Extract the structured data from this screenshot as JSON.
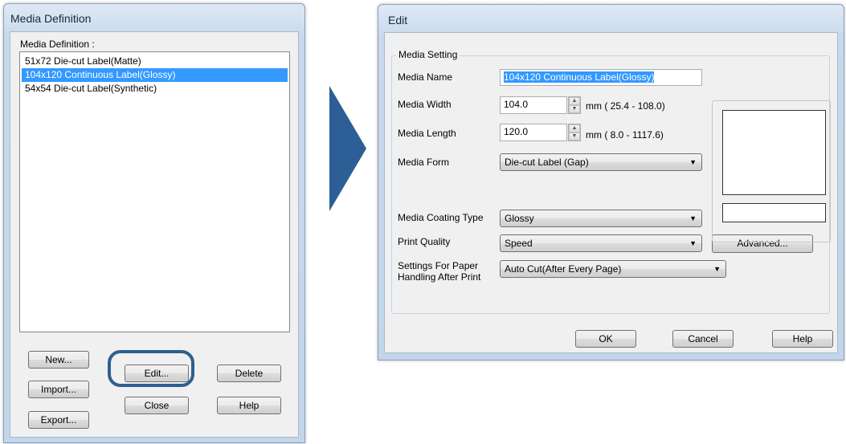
{
  "left_dialog": {
    "title": "Media Definition",
    "list_label": "Media Definition :",
    "items": [
      "51x72 Die-cut Label(Matte)",
      "104x120 Continuous Label(Glossy)",
      "54x54 Die-cut Label(Synthetic)"
    ],
    "selected_index": 1,
    "buttons": {
      "new": "New...",
      "import": "Import...",
      "export": "Export...",
      "edit": "Edit...",
      "close": "Close",
      "delete": "Delete",
      "help": "Help"
    }
  },
  "edit_dialog": {
    "title": "Edit",
    "group_title": "Media Setting",
    "fields": {
      "media_name_label": "Media Name",
      "media_name_value": "104x120 Continuous Label(Glossy)",
      "media_width_label": "Media Width",
      "media_width_value": "104.0",
      "media_width_range": "mm ( 25.4 - 108.0)",
      "media_length_label": "Media Length",
      "media_length_value": "120.0",
      "media_length_range": "mm ( 8.0 - 1117.6)",
      "media_form_label": "Media Form",
      "media_form_value": "Die-cut Label (Gap)",
      "coating_label": "Media Coating Type",
      "coating_value": "Glossy",
      "print_quality_label": "Print Quality",
      "print_quality_value": "Speed",
      "handling_label_1": "Settings For Paper",
      "handling_label_2": "Handling After Print",
      "handling_value": "Auto Cut(After Every Page)"
    },
    "buttons": {
      "advanced": "Advanced...",
      "ok": "OK",
      "cancel": "Cancel",
      "help": "Help"
    }
  },
  "colors": {
    "highlight_ring": "#2f5e90",
    "arrow": "#2b5f95",
    "selection": "#3399ff"
  }
}
